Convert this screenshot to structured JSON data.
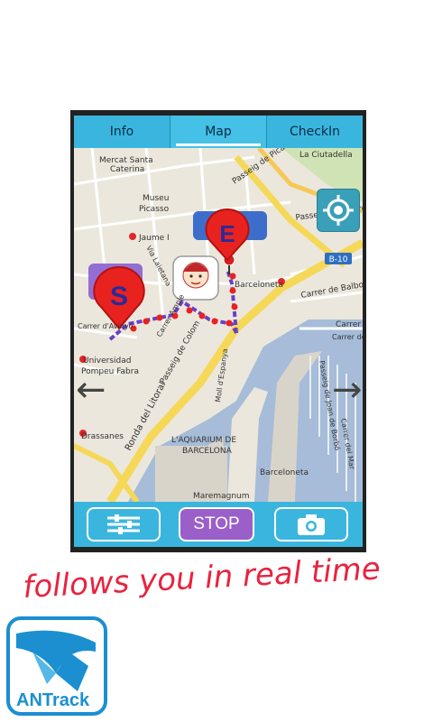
{
  "tabs": [
    {
      "label": "Info",
      "active": false
    },
    {
      "label": "Map",
      "active": true
    },
    {
      "label": "CheckIn",
      "active": false
    }
  ],
  "map": {
    "labels": {
      "mercat": "Mercat Santa",
      "caterina": "Caterina",
      "museu": "Museu",
      "picasso": "Picasso",
      "jaume": "Jaume I",
      "via_laietana": "Via Laietana",
      "passeig_picasso": "Passeig de Picasso",
      "ciutadella": "La Ciutadella",
      "passeig_circ": "Passeig de la Circ",
      "b10": "B-10",
      "barceloneta_station": "Barceloneta",
      "carrer_balboa": "Carrer de Balboa",
      "carrer_m": "Carrer M",
      "carrer_barcelon": "Carrer de Barcelon",
      "carrer_ampl": "Carrer Ample",
      "passeig_colom": "Passeig de Colom",
      "carrer_avinyo": "Carrer d'Avinyó",
      "universidad": "Universidad",
      "pompeu": "Pompeu Fabra",
      "moll_espanya": "Moll d'Espanya",
      "passeig_joan": "Passeig de Joan de Borbó",
      "carrer_mar": "Carrer del Mar",
      "ronda": "Ronda del Litoral",
      "aquarium1": "L'AQUARIUM DE",
      "aquarium2": "BARCELONA",
      "barceloneta2": "Barceloneta",
      "drassanes": "Drassanes",
      "maremagnum": "Maremagnum"
    },
    "markers": {
      "start": "S",
      "end": "E"
    },
    "route_color": "#6a3fc6",
    "marker_color": "#e8231f"
  },
  "bottom": {
    "settings_icon": "sliders-icon",
    "stop_label": "STOP",
    "camera_icon": "camera-icon"
  },
  "tagline": "follows you in real time",
  "logo": {
    "text": "ANTrack",
    "color": "#1b8fd0"
  }
}
